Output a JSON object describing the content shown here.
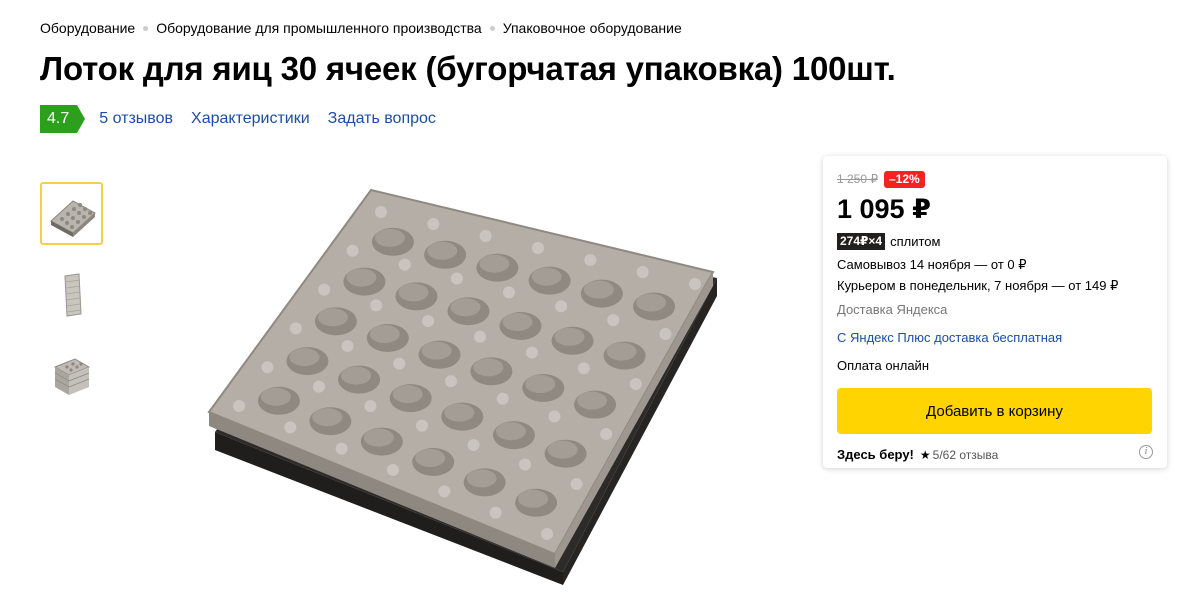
{
  "breadcrumbs": [
    "Оборудование",
    "Оборудование для промышленного производства",
    "Упаковочное оборудование"
  ],
  "title": "Лоток для яиц 30 ячеек (бугорчатая упаковка) 100шт.",
  "rating": {
    "value": "4.7",
    "color": "#2ca01c",
    "reviews_link": "5 отзывов",
    "specs_link": "Характеристики",
    "question_link": "Задать вопрос"
  },
  "gallery": {
    "active_index": 0,
    "thumbnails": [
      "tray-flat-icon",
      "tray-stack-side-icon",
      "tray-stack-top-icon"
    ],
    "main_image": "egg-tray-image"
  },
  "offer": {
    "old_price": "1 250 ₽",
    "discount": "–12%",
    "price": "1 095 ₽",
    "split_badge": "274₽×4",
    "split_label": "сплитом",
    "pickup": "Самовывоз 14 ноября — от 0 ₽",
    "courier": "Курьером в понедельник, 7 ноября — от 149 ₽",
    "delivery_by": "Доставка Яндекса",
    "plus_note": "С Яндекс Плюс доставка бесплатная",
    "payment": "Оплата онлайн",
    "cart_button": "Добавить в корзину",
    "seller_name": "Здесь беру!",
    "seller_rating": "5",
    "seller_reviews": "/62 отзыва",
    "accent_color": "#ffd400",
    "discount_color": "#f52222",
    "link_color": "#1a4dab"
  }
}
